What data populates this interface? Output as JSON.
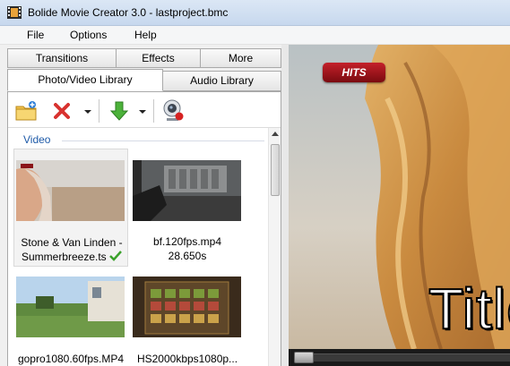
{
  "window": {
    "title": "Bolide Movie Creator 3.0 - lastproject.bmc"
  },
  "menu": {
    "file": "File",
    "options": "Options",
    "help": "Help"
  },
  "tabs": {
    "row1": [
      {
        "label": "Transitions"
      },
      {
        "label": "Effects"
      },
      {
        "label": "More"
      }
    ],
    "row2": [
      {
        "label": "Photo/Video Library",
        "active": true
      },
      {
        "label": "Audio Library",
        "active": false
      }
    ]
  },
  "toolbar": {
    "icons": [
      "add-folder-icon",
      "delete-icon",
      "dropdown-arrow-icon",
      "import-down-arrow-icon",
      "dropdown-arrow-icon",
      "webcam-icon"
    ]
  },
  "library": {
    "group_label": "Video",
    "items": [
      {
        "line1": "Stone & Van Linden -",
        "line2": "Summerbreeze.ts",
        "used": true,
        "selected": true
      },
      {
        "line1": "bf.120fps.mp4",
        "line2": "28.650s",
        "used": false,
        "selected": false
      },
      {
        "line1": "gopro1080.60fps.MP4",
        "line2": "",
        "used": false,
        "selected": false
      },
      {
        "line1": "HS2000kbps1080p...",
        "line2": "",
        "used": false,
        "selected": false
      }
    ]
  },
  "preview": {
    "badge": "HITS",
    "overlay_text": "Title",
    "seek_position": 0.0
  },
  "colors": {
    "accent_blue": "#1e5aa8",
    "badge_red": "#b0141c",
    "check_green": "#3aa12a"
  }
}
